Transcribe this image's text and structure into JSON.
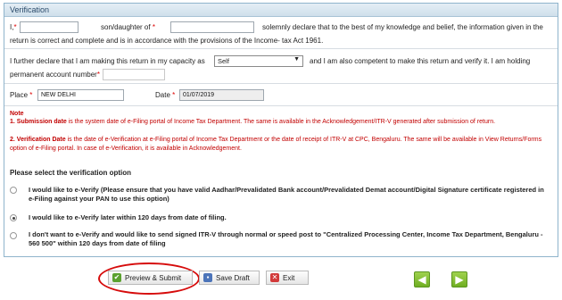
{
  "panel": {
    "title": "Verification"
  },
  "declaration": {
    "i_label": "I,",
    "req": "*",
    "name_value": "",
    "relation_label": "son/daughter of",
    "parent_value": "",
    "text_line1": "solemnly declare that to the best of my knowledge and belief, the information given in the",
    "text_line2": "return is correct and complete and is in accordance with the provisions of the Income- tax Act 1961."
  },
  "capacity": {
    "text_pre": "I further declare that I am making this return in my capacity as",
    "selected": "Self",
    "text_post": "and I am also competent to make this return and verify it. I am holding",
    "pan_label": "permanent account number",
    "pan_value": ""
  },
  "place": {
    "label": "Place",
    "value": "NEW DELHI"
  },
  "date": {
    "label": "Date",
    "value": "01/07/2019"
  },
  "note": {
    "title": "Note",
    "item1_bold": "1. Submission date",
    "item1_text": " is the system date of e-Filing portal of Income Tax Department. The same is available in the Acknowledgement/ITR-V generated after submission of return.",
    "item2_bold": "2. Verification Date",
    "item2_text": " is the date of e-Verification at e-Filing portal of Income Tax Department or the date of receipt of ITR-V at CPC, Bengaluru. The same will be available in View Returns/Forms option of e-Filing portal. In case of e-Verification, it is available in Acknowledgement."
  },
  "verification": {
    "heading": "Please select the verification option",
    "options": [
      {
        "label": "I would like to e-Verify (Please ensure that you have valid Aadhar/Prevalidated Bank account/Prevalidated Demat account/Digital Signature certificate registered in e-Filing against your PAN to use this option)",
        "checked": false
      },
      {
        "label": "I would like to e-Verify later within 120 days from date of filing.",
        "checked": true
      },
      {
        "label": "I don't want to e-Verify and would like to send signed ITR-V through normal or speed post to \"Centralized Processing Center, Income Tax Department, Bengaluru - 560 500\" within 120 days from date of filing",
        "checked": false
      }
    ]
  },
  "actions": {
    "preview_submit": "Preview & Submit",
    "save_draft": "Save Draft",
    "exit": "Exit"
  },
  "nav": {
    "prev_icon": "arrow-left-icon",
    "next_icon": "arrow-right-icon"
  },
  "colors": {
    "note_red": "#c20000",
    "highlight_oval": "#d60b0b",
    "nav_green": "#6fae22"
  }
}
